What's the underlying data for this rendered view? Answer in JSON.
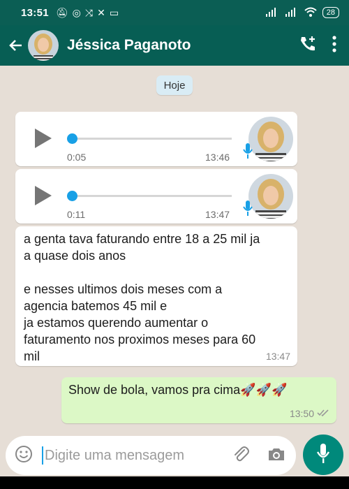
{
  "status_bar": {
    "time": "13:51",
    "battery": "28"
  },
  "header": {
    "contact_name": "Jéssica Paganoto"
  },
  "chat": {
    "date_label": "Hoje",
    "voice_messages": [
      {
        "duration": "0:05",
        "time": "13:46"
      },
      {
        "duration": "0:11",
        "time": "13:47"
      }
    ],
    "incoming_text": {
      "body": "a genta tava faturando entre 18 a 25 mil ja\na quase dois anos\n\ne nesses ultimos dois meses com a\nagencia batemos 45 mil e\nja estamos querendo aumentar o\nfaturamento nos proximos meses para 60\nmil",
      "time": "13:47"
    },
    "outgoing_text": {
      "body": "Show de bola, vamos pra cima🚀🚀🚀",
      "time": "13:50"
    }
  },
  "composer": {
    "placeholder": "Digite uma mensagem"
  },
  "colors": {
    "header": "#075e54",
    "outgoing_bubble": "#dcf8c6",
    "accent": "#18a0e6",
    "mic_button": "#00897b"
  }
}
